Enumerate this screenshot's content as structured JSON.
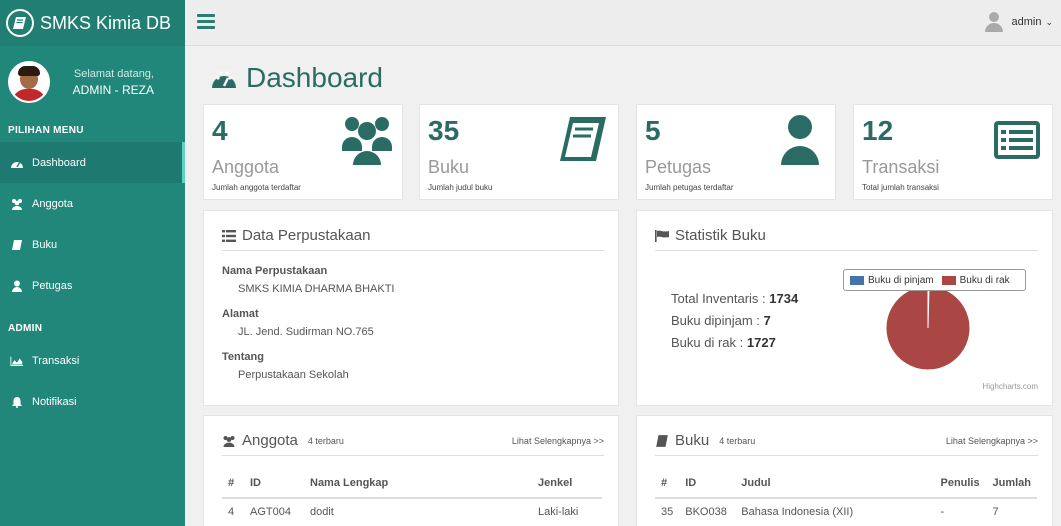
{
  "brand": {
    "title": "SMKS Kimia DB"
  },
  "profile": {
    "greeting": "Selamat datang,",
    "name": "ADMIN - REZA"
  },
  "sidebar": {
    "section_menu": "PILIHAN MENU",
    "section_admin": "ADMIN",
    "items": [
      {
        "label": "Dashboard",
        "icon": "dashboard-icon"
      },
      {
        "label": "Anggota",
        "icon": "users-icon"
      },
      {
        "label": "Buku",
        "icon": "book-icon"
      },
      {
        "label": "Petugas",
        "icon": "user-icon"
      }
    ],
    "admin_items": [
      {
        "label": "Transaksi",
        "icon": "area-chart-icon"
      },
      {
        "label": "Notifikasi",
        "icon": "bell-icon"
      }
    ]
  },
  "topbar": {
    "user": "admin"
  },
  "page": {
    "title": "Dashboard"
  },
  "stats": [
    {
      "number": "4",
      "label": "Anggota",
      "sub": "Jumlah anggota terdaftar",
      "icon": "users-icon"
    },
    {
      "number": "35",
      "label": "Buku",
      "sub": "Jumlah judul buku",
      "icon": "book-icon"
    },
    {
      "number": "5",
      "label": "Petugas",
      "sub": "Jumlah petugas terdaftar",
      "icon": "user-icon"
    },
    {
      "number": "12",
      "label": "Transaksi",
      "sub": "Total jumlah transaksi",
      "icon": "list-icon"
    }
  ],
  "perpustakaan": {
    "title": "Data Perpustakaan",
    "fields": [
      {
        "label": "Nama Perpustakaan",
        "value": "SMKS KIMIA DHARMA BHAKTI"
      },
      {
        "label": "Alamat",
        "value": "JL. Jend. Sudirman NO.765"
      },
      {
        "label": "Tentang",
        "value": "Perpustakaan Sekolah"
      }
    ]
  },
  "statistik": {
    "title": "Statistik Buku",
    "inventaris_label": "Total Inventaris : ",
    "inventaris_value": "1734",
    "dipinjam_label": "Buku dipinjam : ",
    "dipinjam_value": "7",
    "dirak_label": "Buku di rak : ",
    "dirak_value": "1727",
    "credits": "Highcharts.com",
    "colors": {
      "dipinjam": "#4572a7",
      "rak": "#aa4643"
    }
  },
  "chart_data": {
    "type": "pie",
    "series": [
      {
        "name": "Buku di pinjam",
        "value": 7
      },
      {
        "name": "Buku di rak",
        "value": 1727
      }
    ]
  },
  "anggota": {
    "title": "Anggota",
    "subtitle": "4 terbaru",
    "link": "Lihat Selengkapnya >>",
    "columns": [
      "#",
      "ID",
      "Nama Lengkap",
      "Jenkel"
    ],
    "rows": [
      [
        "4",
        "AGT004",
        "dodit",
        "Laki-laki"
      ]
    ]
  },
  "buku": {
    "title": "Buku",
    "subtitle": "4 terbaru",
    "link": "Lihat Selengkapnya >>",
    "columns": [
      "#",
      "ID",
      "Judul",
      "Penulis",
      "Jumlah"
    ],
    "rows": [
      [
        "35",
        "BKO038",
        "Bahasa Indonesia (XII)",
        "-",
        "7"
      ]
    ]
  }
}
